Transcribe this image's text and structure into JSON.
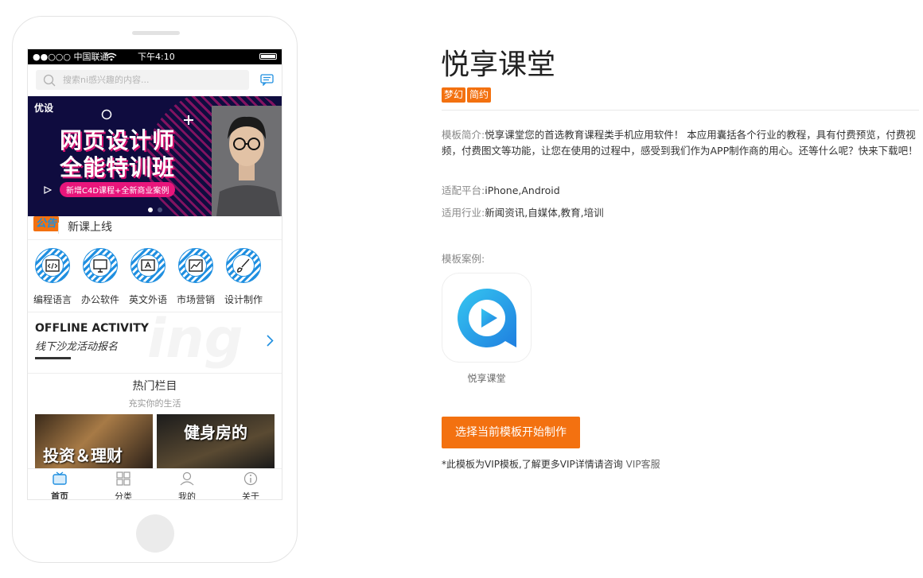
{
  "phone": {
    "status": {
      "carrier": "●●○○○ 中国联通",
      "time": "下午4:10"
    },
    "search_placeholder": "搜索ni感兴趣的内容...",
    "banner": {
      "brand": "优设",
      "title_line1": "网页设计师",
      "title_line2": "全能特训班",
      "ribbon": "新增C4D课程+全新商业案例"
    },
    "notice": {
      "tag": "公告",
      "text": "新课上线"
    },
    "categories": [
      {
        "label": "编程语言",
        "icon": "code-icon"
      },
      {
        "label": "办公软件",
        "icon": "monitor-icon"
      },
      {
        "label": "英文外语",
        "icon": "letter-a-icon"
      },
      {
        "label": "市场营销",
        "icon": "chart-icon"
      },
      {
        "label": "设计制作",
        "icon": "brush-icon"
      }
    ],
    "offline": {
      "title": "OFFLINE ACTIVITY",
      "subtitle": "线下沙龙活动报名",
      "bg_text": "ing"
    },
    "hot": {
      "title": "热门栏目",
      "subtitle": "充实你的生活",
      "cards": [
        {
          "caption": "投资＆理财"
        },
        {
          "caption": "健身房的"
        }
      ]
    },
    "tabs": [
      {
        "label": "首页",
        "icon": "tv-icon"
      },
      {
        "label": "分类",
        "icon": "grid-icon"
      },
      {
        "label": "我的",
        "icon": "user-icon"
      },
      {
        "label": "关于",
        "icon": "info-icon"
      }
    ]
  },
  "template": {
    "title": "悦享课堂",
    "tags": [
      "梦幻",
      "简约"
    ],
    "intro_label": "模板简介:",
    "intro": "悦享课堂您的首选教育课程类手机应用软件！ 本应用囊括各个行业的教程，具有付费预览，付费视频，付费图文等功能，让您在使用的过程中，感受到我们作为APP制作商的用心。还等什么呢？快来下载吧！",
    "platform_label": "适配平台:",
    "platform": "iPhone,Android",
    "industry_label": "适用行业:",
    "industry": "新闻资讯,自媒体,教育,培训",
    "case_label": "模板案例:",
    "case_app_name": "悦享课堂",
    "cta": "选择当前模板开始制作",
    "note": "*此模板为VIP模板,了解更多VIP详情请咨询",
    "note_link": "VIP客服"
  },
  "colors": {
    "accent": "#f37110",
    "blue": "#1f8fe0"
  }
}
